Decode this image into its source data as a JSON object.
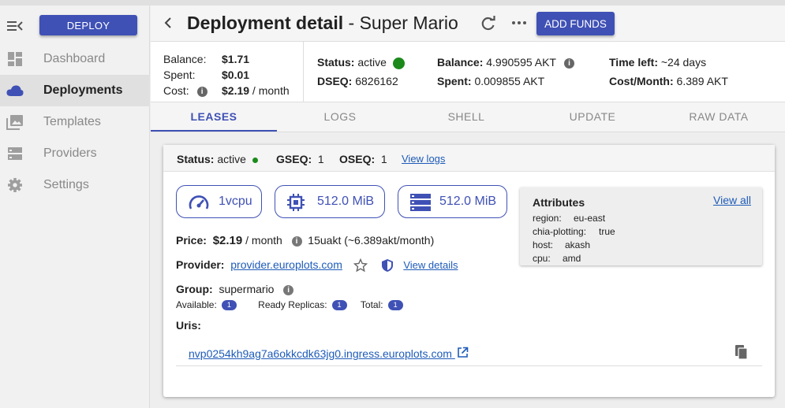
{
  "sidebar": {
    "deploy_label": "DEPLOY",
    "items": [
      {
        "label": "Dashboard",
        "icon": "dashboard-icon"
      },
      {
        "label": "Deployments",
        "icon": "cloud-icon",
        "active": true
      },
      {
        "label": "Templates",
        "icon": "photo-library-icon"
      },
      {
        "label": "Providers",
        "icon": "storage-icon"
      },
      {
        "label": "Settings",
        "icon": "gear-icon"
      }
    ]
  },
  "header": {
    "title": "Deployment detail",
    "separator": " - ",
    "deployment_name": "Super Mario",
    "add_funds_label": "ADD FUNDS"
  },
  "summary": {
    "balance_label": "Balance:",
    "balance": "$1.71",
    "spent_label": "Spent:",
    "spent": "$0.01",
    "cost_label": "Cost:",
    "cost": "$2.19",
    "cost_unit": " / month",
    "status_label": "Status:",
    "status": "active",
    "dseq_label": "DSEQ:",
    "dseq": "6826162",
    "balance_akt_label": "Balance:",
    "balance_akt": "4.990595 AKT",
    "spent_akt_label": "Spent:",
    "spent_akt": "0.009855 AKT",
    "time_left_label": "Time left:",
    "time_left": "~24 days",
    "cost_month_label": "Cost/Month:",
    "cost_month": "6.389 AKT"
  },
  "tabs": [
    "LEASES",
    "LOGS",
    "SHELL",
    "UPDATE",
    "RAW DATA"
  ],
  "lease": {
    "status_label": "Status:",
    "status": "active",
    "gseq_label": "GSEQ:",
    "gseq": "1",
    "oseq_label": "OSEQ:",
    "oseq": "1",
    "view_logs": "View logs",
    "cpu": "1vcpu",
    "memory": "512.0 MiB",
    "storage": "512.0 MiB",
    "price_label": "Price:",
    "price": "$2.19",
    "price_unit": " / month",
    "price_detail": "15uakt (~6.389akt/month)",
    "provider_label": "Provider:",
    "provider": "provider.europlots.com",
    "view_details": "View details",
    "group_label": "Group:",
    "group": "supermario",
    "available_label": "Available:",
    "available": "1",
    "ready_label": "Ready Replicas:",
    "ready": "1",
    "total_label": "Total:",
    "total": "1",
    "uris_label": "Uris:",
    "uri": "nvp0254kh9ag7a6okkcdk63jg0.ingress.europlots.com",
    "attributes": {
      "title": "Attributes",
      "view_all": "View all",
      "items": [
        {
          "key": "region:",
          "value": "eu-east"
        },
        {
          "key": "chia-plotting:",
          "value": "true"
        },
        {
          "key": "host:",
          "value": "akash"
        },
        {
          "key": "cpu:",
          "value": "amd"
        }
      ]
    }
  },
  "colors": {
    "primary": "#3f51b5",
    "status_active": "#1b8a1b",
    "link": "#1e5bb8"
  }
}
